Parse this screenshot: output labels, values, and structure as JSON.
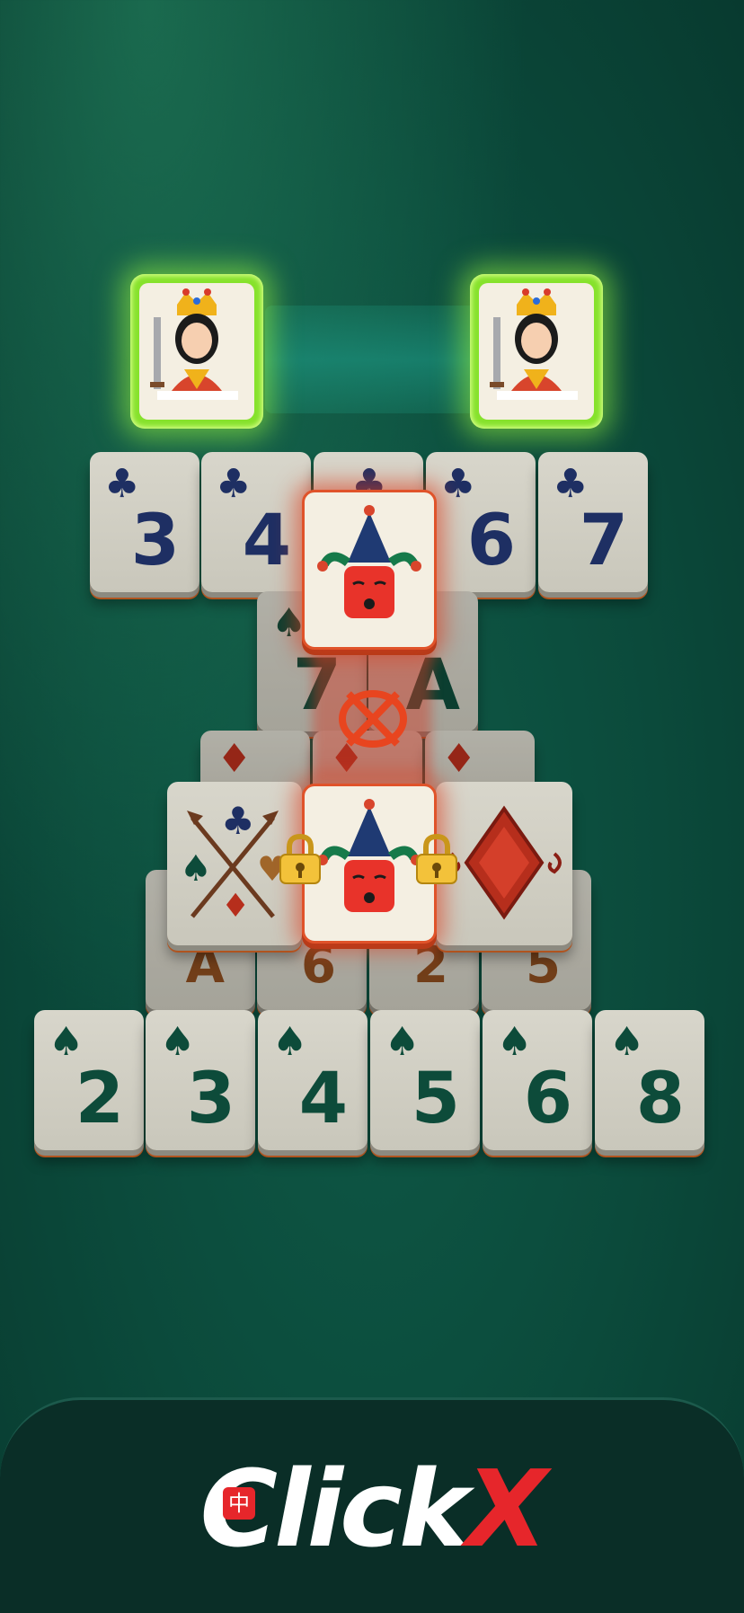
{
  "selected_pair": [
    {
      "card": "queen",
      "icon": "queen-icon"
    },
    {
      "card": "queen",
      "icon": "queen-icon"
    }
  ],
  "row1": [
    {
      "suit": "♣",
      "value": "3"
    },
    {
      "suit": "♣",
      "value": "4"
    },
    {
      "suit": "♣",
      "value": ""
    },
    {
      "suit": "♣",
      "value": "6"
    },
    {
      "suit": "♣",
      "value": "7"
    }
  ],
  "row2": [
    {
      "suit": "♠",
      "value": "7"
    },
    {
      "suit": "",
      "value": "A"
    }
  ],
  "row3_diamonds": [
    "♦",
    "♦",
    "♦"
  ],
  "row4": [
    {
      "icon": "crossed-arrows-suits-icon"
    },
    {
      "icon": "joker-icon",
      "locked": true
    },
    {
      "icon": "ornate-diamond-icon"
    }
  ],
  "row5": [
    {
      "value": "A"
    },
    {
      "value": "6"
    },
    {
      "value": "2"
    },
    {
      "value": "5"
    }
  ],
  "row6": [
    {
      "suit": "♠",
      "value": "2"
    },
    {
      "suit": "♠",
      "value": "3"
    },
    {
      "suit": "♠",
      "value": "4"
    },
    {
      "suit": "♠",
      "value": "5"
    },
    {
      "suit": "♠",
      "value": "6"
    },
    {
      "suit": "♠",
      "value": "8"
    }
  ],
  "blocked_icon": "no-match-icon",
  "brand": {
    "logo_text": "Click",
    "logo_x": "X",
    "logo_badge": "中"
  },
  "colors": {
    "club": "#1e2f63",
    "spade": "#0d4b3a",
    "diamond": "#b62e1c",
    "glow": "#86e22c",
    "joker_border": "#e0532a"
  }
}
